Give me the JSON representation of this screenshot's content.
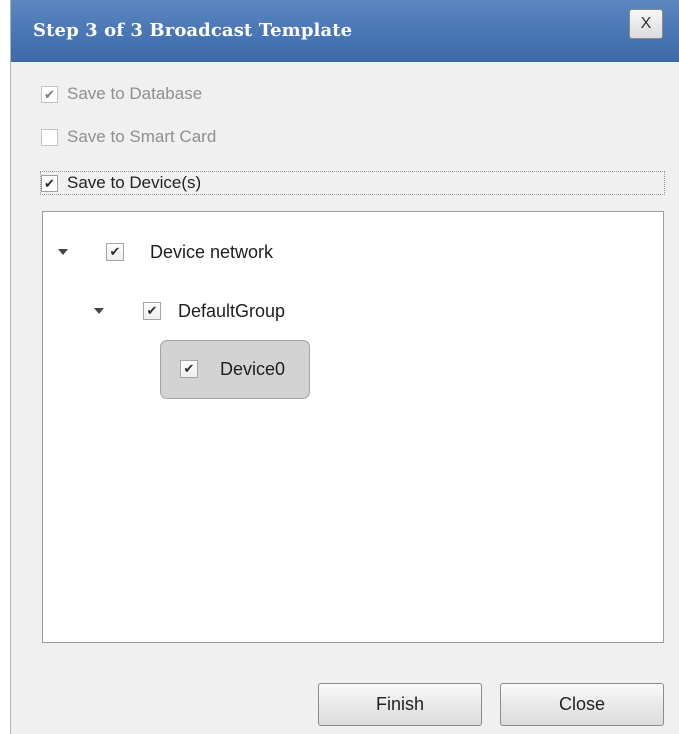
{
  "dialog": {
    "title": "Step 3 of 3 Broadcast Template",
    "close_glyph": "X"
  },
  "options": {
    "save_database": {
      "label": "Save to Database",
      "checked": true,
      "enabled": false
    },
    "save_smartcard": {
      "label": "Save to Smart Card",
      "checked": false,
      "enabled": false
    },
    "save_devices": {
      "label": "Save to Device(s)",
      "checked": true,
      "enabled": true
    }
  },
  "check_glyph": "✔",
  "tree": {
    "network": {
      "label": "Device network",
      "expanded": true,
      "checked": true
    },
    "group": {
      "label": "DefaultGroup",
      "expanded": true,
      "checked": true
    },
    "device": {
      "label": "Device0",
      "checked": true,
      "selected": true
    }
  },
  "buttons": {
    "finish": "Finish",
    "close": "Close"
  },
  "icons": {
    "close": "close-icon",
    "check": "checkmark-icon",
    "expander": "chevron-down-icon"
  }
}
